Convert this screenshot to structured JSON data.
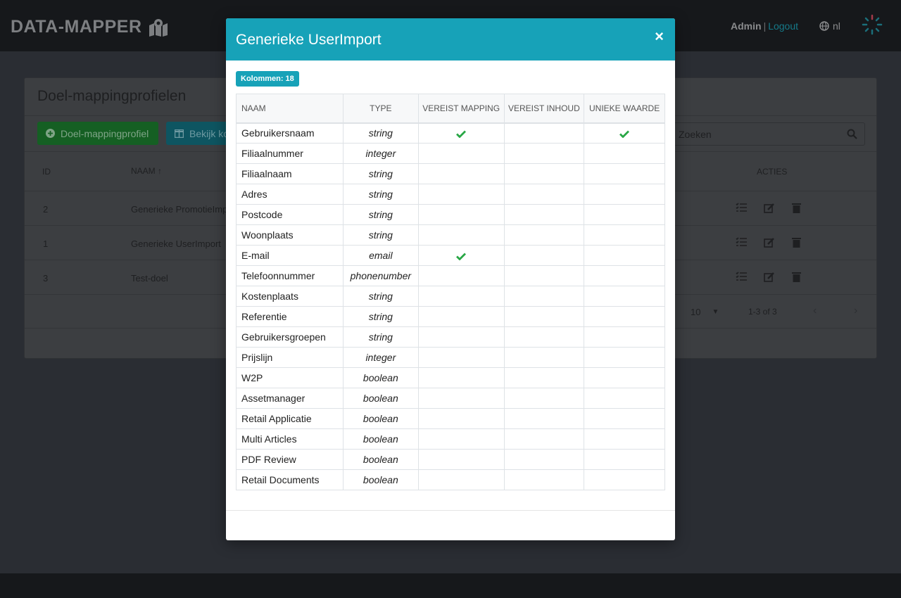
{
  "brand": {
    "name": "DATA-MAPPER",
    "icon": "map-marked-icon"
  },
  "nav": {
    "user": "Admin",
    "separator": "|",
    "logout": "Logout",
    "language": "nl"
  },
  "page": {
    "title": "Doel-mappingprofielen",
    "add_button": "Doel-mappingprofiel",
    "columns_button": "Bekijk ko",
    "search_placeholder": "Zoeken",
    "headers": {
      "id": "ID",
      "naam": "NAAM",
      "acties": "ACTIES"
    },
    "rows": [
      {
        "id": "2",
        "naam": "Generieke PromotieImp"
      },
      {
        "id": "1",
        "naam": "Generieke UserImport"
      },
      {
        "id": "3",
        "naam": "Test-doel"
      }
    ],
    "rows_per_page": "10",
    "range": "1-3 of 3"
  },
  "modal": {
    "title": "Generieke UserImport",
    "close": "×",
    "badge": "Kolommen: 18",
    "headers": {
      "naam": "NAAM",
      "type": "TYPE",
      "vereist_mapping": "VEREIST MAPPING",
      "vereist_inhoud": "VEREIST INHOUD",
      "unieke_waarde": "UNIEKE WAARDE"
    },
    "rows": [
      {
        "naam": "Gebruikersnaam",
        "type": "string",
        "mapping": true,
        "inhoud": false,
        "uniek": true
      },
      {
        "naam": "Filiaalnummer",
        "type": "integer",
        "mapping": false,
        "inhoud": false,
        "uniek": false
      },
      {
        "naam": "Filiaalnaam",
        "type": "string",
        "mapping": false,
        "inhoud": false,
        "uniek": false
      },
      {
        "naam": "Adres",
        "type": "string",
        "mapping": false,
        "inhoud": false,
        "uniek": false
      },
      {
        "naam": "Postcode",
        "type": "string",
        "mapping": false,
        "inhoud": false,
        "uniek": false
      },
      {
        "naam": "Woonplaats",
        "type": "string",
        "mapping": false,
        "inhoud": false,
        "uniek": false
      },
      {
        "naam": "E-mail",
        "type": "email",
        "mapping": true,
        "inhoud": false,
        "uniek": false
      },
      {
        "naam": "Telefoonnummer",
        "type": "phonenumber",
        "mapping": false,
        "inhoud": false,
        "uniek": false
      },
      {
        "naam": "Kostenplaats",
        "type": "string",
        "mapping": false,
        "inhoud": false,
        "uniek": false
      },
      {
        "naam": "Referentie",
        "type": "string",
        "mapping": false,
        "inhoud": false,
        "uniek": false
      },
      {
        "naam": "Gebruikersgroepen",
        "type": "string",
        "mapping": false,
        "inhoud": false,
        "uniek": false
      },
      {
        "naam": "Prijslijn",
        "type": "integer",
        "mapping": false,
        "inhoud": false,
        "uniek": false
      },
      {
        "naam": "W2P",
        "type": "boolean",
        "mapping": false,
        "inhoud": false,
        "uniek": false
      },
      {
        "naam": "Assetmanager",
        "type": "boolean",
        "mapping": false,
        "inhoud": false,
        "uniek": false
      },
      {
        "naam": "Retail Applicatie",
        "type": "boolean",
        "mapping": false,
        "inhoud": false,
        "uniek": false
      },
      {
        "naam": "Multi Articles",
        "type": "boolean",
        "mapping": false,
        "inhoud": false,
        "uniek": false
      },
      {
        "naam": "PDF Review",
        "type": "boolean",
        "mapping": false,
        "inhoud": false,
        "uniek": false
      },
      {
        "naam": "Retail Documents",
        "type": "boolean",
        "mapping": false,
        "inhoud": false,
        "uniek": false
      }
    ]
  },
  "colors": {
    "accent": "#17a2b8",
    "success": "#28a745",
    "overlay_bg": "#2a2d33"
  }
}
